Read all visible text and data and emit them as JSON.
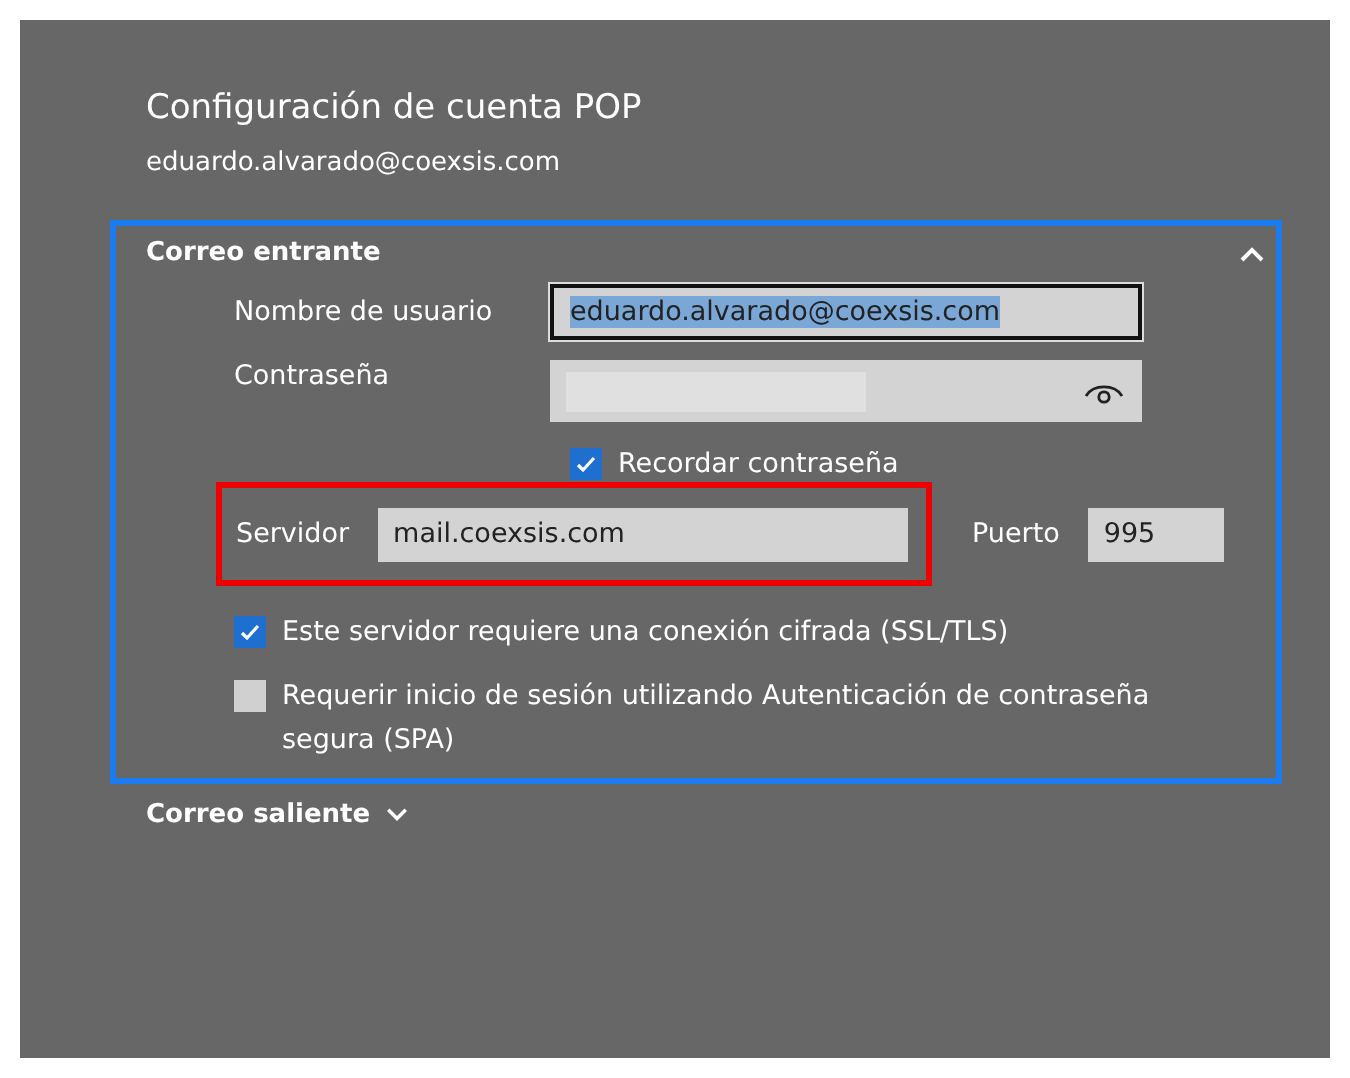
{
  "title": "Configuración de cuenta POP",
  "account": "eduardo.alvarado@coexsis.com",
  "incoming": {
    "title": "Correo entrante",
    "expanded": true,
    "focused": true,
    "username": {
      "label": "Nombre de usuario",
      "value": "eduardo.alvarado@coexsis.com",
      "selected": true
    },
    "password": {
      "label": "Contraseña"
    },
    "remember": {
      "label": "Recordar contraseña",
      "checked": true
    },
    "server": {
      "label": "Servidor",
      "value": "mail.coexsis.com",
      "highlighted": true
    },
    "port": {
      "label": "Puerto",
      "value": "995"
    },
    "options": [
      {
        "label": "Este servidor requiere una conexión cifrada (SSL/TLS)",
        "checked": true
      },
      {
        "label": "Requerir inicio de sesión utilizando Autenticación de contraseña segura (SPA)",
        "checked": false
      }
    ]
  },
  "outgoing": {
    "title": "Correo saliente",
    "expanded": false
  }
}
